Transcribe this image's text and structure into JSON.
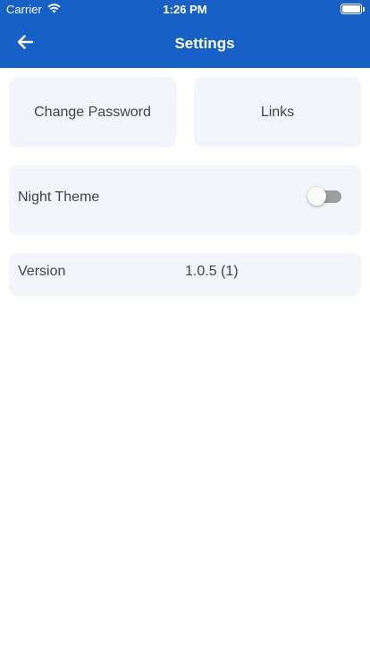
{
  "status_bar": {
    "carrier": "Carrier",
    "time": "1:26 PM",
    "wifi_icon": "wifi-icon",
    "battery_icon": "battery-icon"
  },
  "nav": {
    "title": "Settings",
    "back_icon": "arrow-left-icon"
  },
  "actions": {
    "change_password": "Change Password",
    "links": "Links"
  },
  "night_theme": {
    "label": "Night Theme",
    "enabled": false
  },
  "version": {
    "label": "Version",
    "value": "1.0.5 (1)"
  },
  "colors": {
    "header": "#1760c5",
    "card_background": "#f2f5f9",
    "text": "#404448",
    "toggle_track_off": "#9e9e9e"
  }
}
